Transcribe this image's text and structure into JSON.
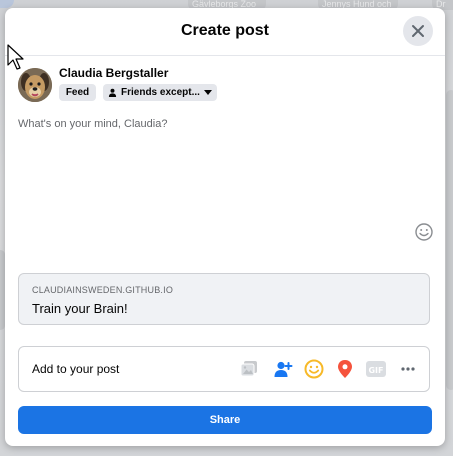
{
  "background": {
    "tiles": [
      "Gävleborgs Zoo",
      "Jennys Hund och",
      "Dr"
    ]
  },
  "dialog": {
    "title": "Create post",
    "close_icon": "close-icon"
  },
  "user": {
    "name": "Claudia Bergstaller",
    "avatar": "dog-avatar"
  },
  "audience": {
    "feed_label": "Feed",
    "privacy_label": "Friends except...",
    "privacy_icon": "friends-icon",
    "caret_icon": "caret-down-icon"
  },
  "composer": {
    "placeholder": "What's on your mind, Claudia?"
  },
  "link_preview": {
    "domain": "CLAUDIAINSWEDEN.GITHUB.IO",
    "title": "Train your Brain!"
  },
  "add_to_post": {
    "label": "Add to your post",
    "tools": [
      "photo-video-icon",
      "tag-people-icon",
      "feeling-icon",
      "check-in-icon",
      "gif-icon",
      "more-icon"
    ]
  },
  "share": {
    "label": "Share"
  },
  "colors": {
    "accent": "#1b74e4",
    "feeling": "#f7b928",
    "check_in": "#f5533d",
    "tag": "#1877f2"
  }
}
